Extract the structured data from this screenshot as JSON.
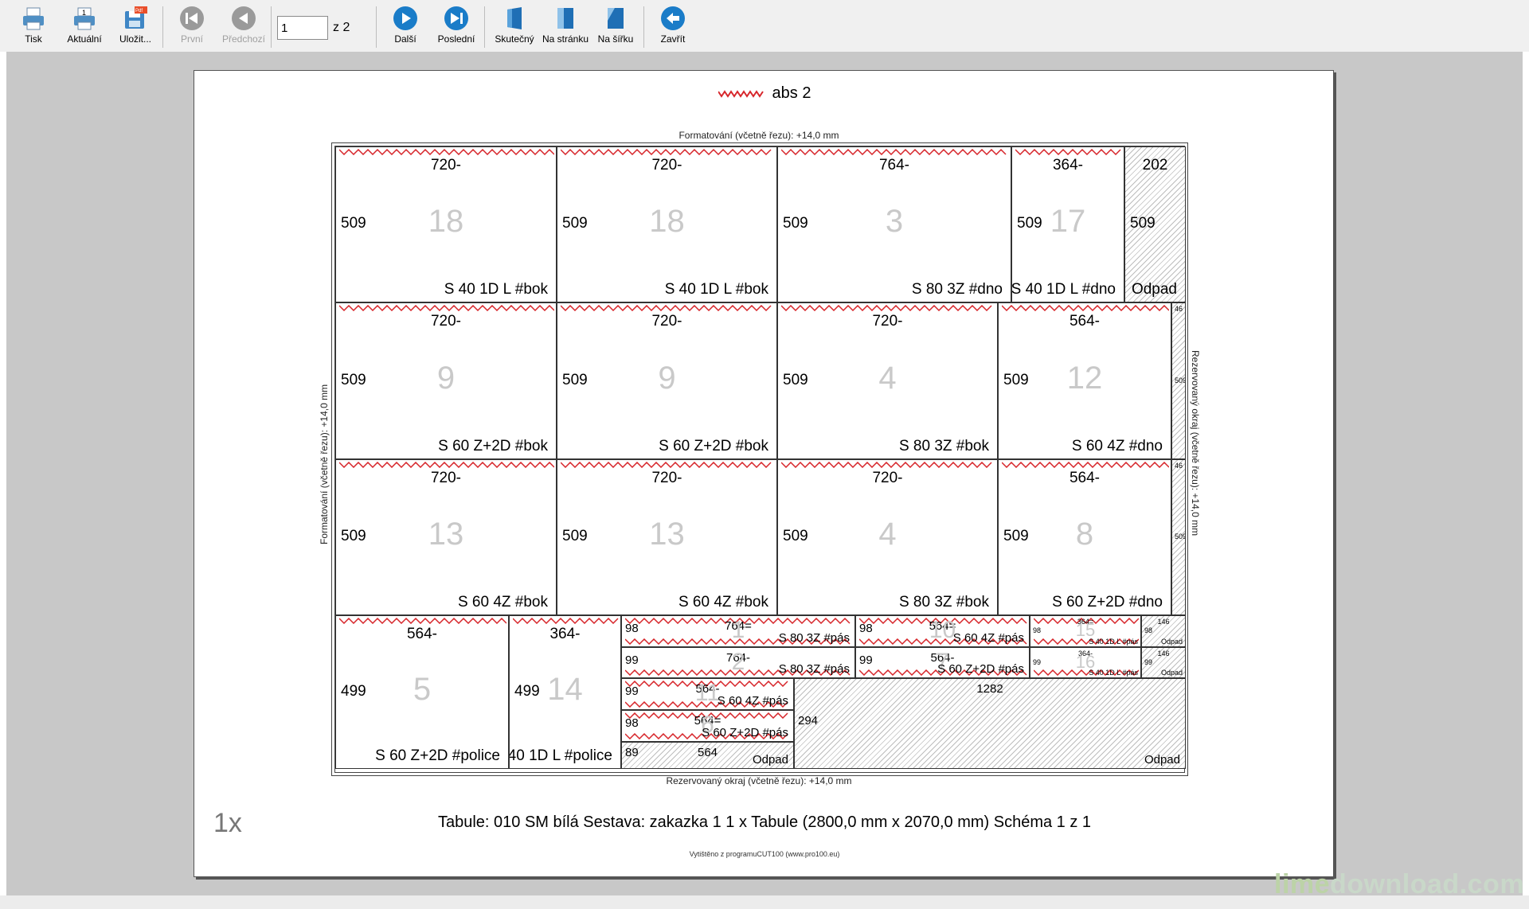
{
  "toolbar": {
    "print": "Tisk",
    "refresh": "Aktuální",
    "save": "Uložit...",
    "first": "První",
    "prev": "Předchozí",
    "page_value": "1",
    "page_of": "z 2",
    "next": "Další",
    "last": "Poslední",
    "actual": "Skutečný",
    "fit_page": "Na stránku",
    "fit_width": "Na šířku",
    "close": "Zavřít"
  },
  "document": {
    "title": "abs 2",
    "top_caption": "Formatování (včetně řezu): +14,0 mm",
    "left_caption": "Formatování (včetně řezu): +14,0 mm",
    "right_caption": "Rezervovaný okraj (včetně řezu): +14,0 mm",
    "bottom_caption": "Rezervovaný okraj (včetně řezu): +14,0 mm",
    "count": "1x",
    "summary": "Tabule: 010 SM bílá  Sestava: zakazka 1  1 x Tabule (2800,0 mm x 2070,0 mm)  Schéma 1 z 1",
    "footer": "Vytištěno z programuCUT100 (www.pro100.eu)"
  },
  "parts": [
    {
      "w": "720-",
      "h": "509",
      "n": "18",
      "label": "S 40 1D L #bok"
    },
    {
      "w": "720-",
      "h": "509",
      "n": "18",
      "label": "S 40 1D L #bok"
    },
    {
      "w": "764-",
      "h": "509",
      "n": "3",
      "label": "S 80 3Z #dno"
    },
    {
      "w": "364-",
      "h": "509",
      "n": "17",
      "label": "S 40 1D L #dno"
    },
    {
      "w": "202",
      "h": "509",
      "n": "",
      "label": "Odpad"
    },
    {
      "w": "720-",
      "h": "509",
      "n": "9",
      "label": "S 60 Z+2D #bok"
    },
    {
      "w": "720-",
      "h": "509",
      "n": "9",
      "label": "S 60 Z+2D #bok"
    },
    {
      "w": "720-",
      "h": "509",
      "n": "4",
      "label": "S 80 3Z #bok"
    },
    {
      "w": "564-",
      "h": "509",
      "n": "12",
      "label": "S 60 4Z #dno"
    },
    {
      "w": "46",
      "h": "509",
      "n": "",
      "label": ""
    },
    {
      "w": "720-",
      "h": "509",
      "n": "13",
      "label": "S 60 4Z #bok"
    },
    {
      "w": "720-",
      "h": "509",
      "n": "13",
      "label": "S 60 4Z #bok"
    },
    {
      "w": "720-",
      "h": "509",
      "n": "4",
      "label": "S 80 3Z #bok"
    },
    {
      "w": "564-",
      "h": "509",
      "n": "8",
      "label": "S 60 Z+2D #dno"
    },
    {
      "w": "46",
      "h": "509",
      "n": "",
      "label": ""
    },
    {
      "w": "564-",
      "h": "499",
      "n": "5",
      "label": "S 60 Z+2D #police"
    },
    {
      "w": "364-",
      "h": "499",
      "n": "14",
      "label": "S 40 1D L #police"
    },
    {
      "w": "764=",
      "h": "98",
      "n": "1",
      "label": "S 80 3Z #pás"
    },
    {
      "w": "564=",
      "h": "98",
      "n": "10",
      "label": "S 60 4Z #pás"
    },
    {
      "w": "364=",
      "h": "98",
      "n": "15",
      "label": "S 40 1D L #pás"
    },
    {
      "w": "146",
      "h": "98",
      "n": "",
      "label": "Odpad"
    },
    {
      "w": "764-",
      "h": "99",
      "n": "2",
      "label": "S 80 3Z #pás"
    },
    {
      "w": "564-",
      "h": "99",
      "n": "7",
      "label": "S 60 Z+2D #pás"
    },
    {
      "w": "364-",
      "h": "99",
      "n": "16",
      "label": "S 40 1D L #pás"
    },
    {
      "w": "146",
      "h": "99",
      "n": "",
      "label": "Odpad"
    },
    {
      "w": "564-",
      "h": "99",
      "n": "11",
      "label": "S 60 4Z #pás"
    },
    {
      "w": "564=",
      "h": "98",
      "n": "6",
      "label": "S 60 Z+2D #pás"
    },
    {
      "w": "564",
      "h": "89",
      "n": "",
      "label": "Odpad"
    },
    {
      "w": "1282",
      "h": "294",
      "n": "",
      "label": "Odpad"
    }
  ],
  "watermark": {
    "a": "lime",
    "b": "download.com"
  },
  "colors": {
    "edge_band": "#d7262b",
    "accent": "#1a7cc8"
  }
}
